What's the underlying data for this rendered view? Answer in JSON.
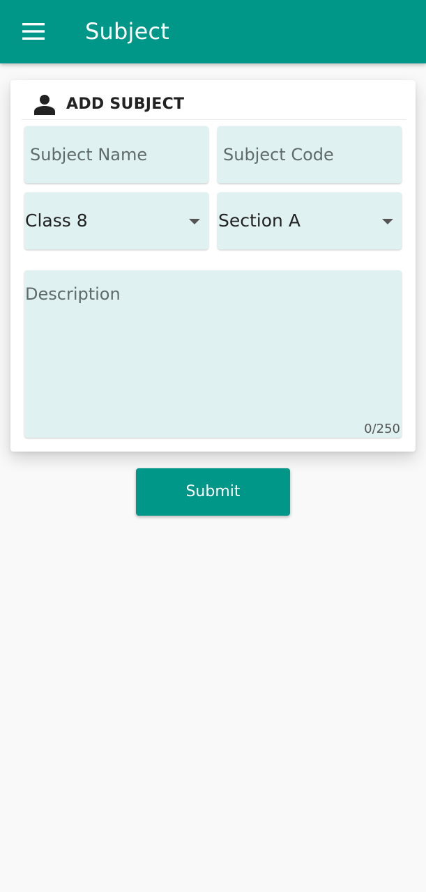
{
  "app_bar": {
    "title": "Subject",
    "menu_icon": "menu-icon",
    "color": "#009688"
  },
  "form": {
    "header_icon": "person-icon",
    "header_title": "ADD SUBJECT",
    "subject_name": {
      "value": "",
      "placeholder": "Subject Name"
    },
    "subject_code": {
      "value": "",
      "placeholder": "Subject Code"
    },
    "class_select": {
      "selected": "Class 8",
      "icon": "arrow-drop-down-icon"
    },
    "section_select": {
      "selected": "Section A",
      "icon": "arrow-drop-down-icon"
    },
    "description": {
      "value": "",
      "placeholder": "Description",
      "counter": "0/250"
    },
    "field_background": "#e0f1f1"
  },
  "submit_button": {
    "label": "Submit",
    "color": "#009688"
  }
}
